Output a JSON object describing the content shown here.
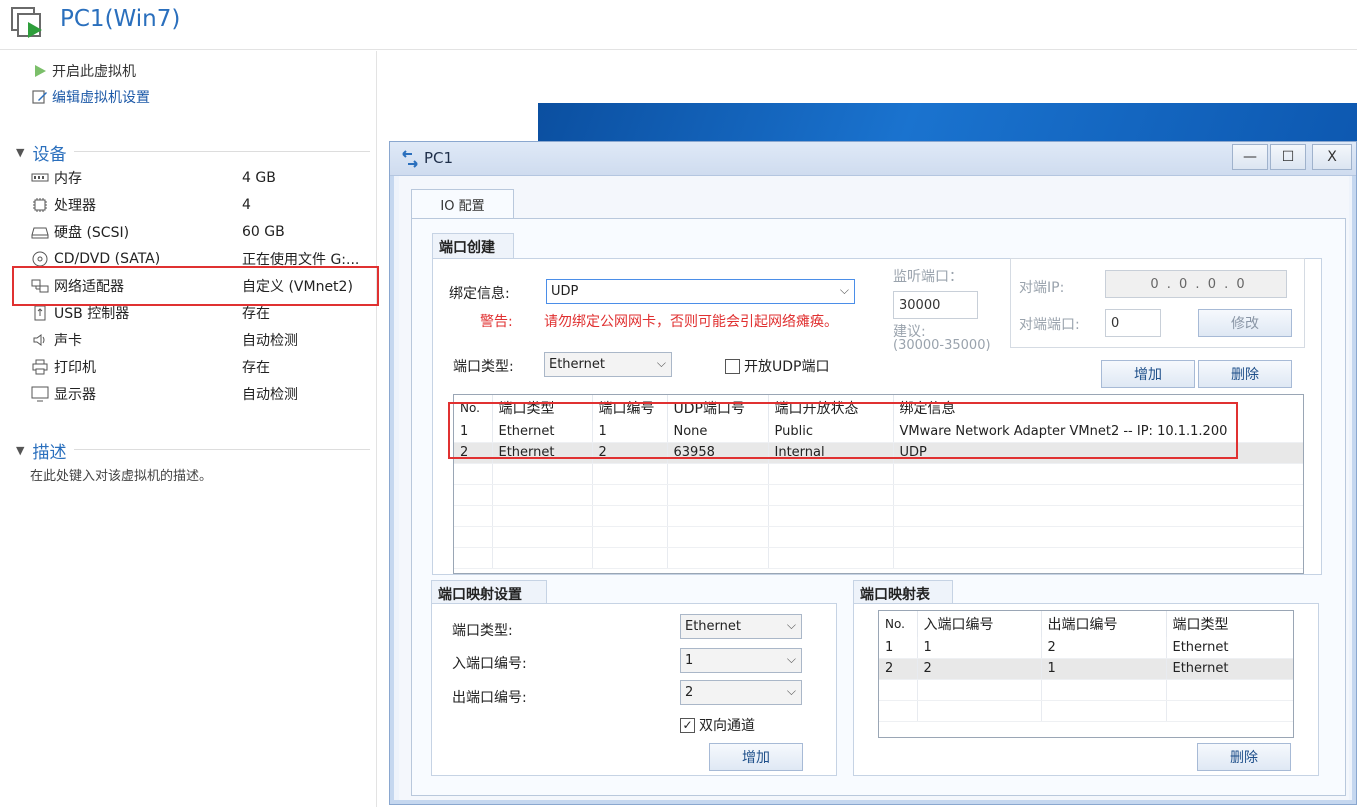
{
  "header": {
    "title": "PC1(Win7)",
    "icon": "vm-play-icon"
  },
  "actions": [
    {
      "label": "开启此虚拟机",
      "icon": "play-icon"
    },
    {
      "label": "编辑虚拟机设置",
      "icon": "edit-icon"
    }
  ],
  "devices_section": {
    "title": "设备",
    "items": [
      {
        "name": "内存",
        "value": "4 GB",
        "icon": "memory-icon"
      },
      {
        "name": "处理器",
        "value": "4",
        "icon": "cpu-icon"
      },
      {
        "name": "硬盘 (SCSI)",
        "value": "60 GB",
        "icon": "disk-icon"
      },
      {
        "name": "CD/DVD (SATA)",
        "value": "正在使用文件 G:...",
        "icon": "cd-icon"
      },
      {
        "name": "网络适配器",
        "value": "自定义 (VMnet2)",
        "icon": "network-icon"
      },
      {
        "name": "USB 控制器",
        "value": "存在",
        "icon": "usb-icon"
      },
      {
        "name": "声卡",
        "value": "自动检测",
        "icon": "speaker-icon"
      },
      {
        "name": "打印机",
        "value": "存在",
        "icon": "printer-icon"
      },
      {
        "name": "显示器",
        "value": "自动检测",
        "icon": "monitor-icon"
      }
    ]
  },
  "description_section": {
    "title": "描述",
    "placeholder": "在此处键入对该虚拟机的描述。"
  },
  "dialog": {
    "title": "PC1",
    "window_buttons": {
      "minimize": "—",
      "maximize": "☐",
      "close": "X"
    },
    "tab": "IO 配置",
    "port_create": {
      "group_title": "端口创建",
      "bind_label": "绑定信息:",
      "bind_value": "UDP",
      "warning_label": "警告:",
      "warning_text": "请勿绑定公网网卡，否则可能会引起网络瘫痪。",
      "listen_port_label": "监听端口：",
      "listen_port_value": "30000",
      "suggest_label": "建议:",
      "suggest_range": "(30000-35000)",
      "remote_ip_label": "对端IP:",
      "remote_ip_value": "0 . 0 . 0 . 0",
      "remote_port_label": "对端端口:",
      "remote_port_value": "0",
      "modify_button": "修改",
      "port_type_label": "端口类型:",
      "port_type_value": "Ethernet",
      "open_udp_label": "开放UDP端口",
      "add_button": "增加",
      "delete_button": "删除",
      "table": {
        "columns": [
          "No.",
          "端口类型",
          "端口编号",
          "UDP端口号",
          "端口开放状态",
          "绑定信息"
        ],
        "rows": [
          [
            "1",
            "Ethernet",
            "1",
            "None",
            "Public",
            "VMware Network Adapter VMnet2 -- IP: 10.1.1.200"
          ],
          [
            "2",
            "Ethernet",
            "2",
            "63958",
            "Internal",
            "UDP"
          ]
        ]
      }
    },
    "port_mapping_settings": {
      "group_title": "端口映射设置",
      "port_type_label": "端口类型:",
      "port_type_value": "Ethernet",
      "in_port_label": "入端口编号:",
      "in_port_value": "1",
      "out_port_label": "出端口编号:",
      "out_port_value": "2",
      "bidirectional_label": "双向通道",
      "add_button": "增加"
    },
    "port_mapping_table": {
      "group_title": "端口映射表",
      "columns": [
        "No.",
        "入端口编号",
        "出端口编号",
        "端口类型"
      ],
      "rows": [
        [
          "1",
          "1",
          "2",
          "Ethernet"
        ],
        [
          "2",
          "2",
          "1",
          "Ethernet"
        ]
      ],
      "delete_button": "删除"
    }
  },
  "colors": {
    "accent": "#2a6fbd",
    "highlight": "#e03131",
    "warning": "#e03131"
  }
}
